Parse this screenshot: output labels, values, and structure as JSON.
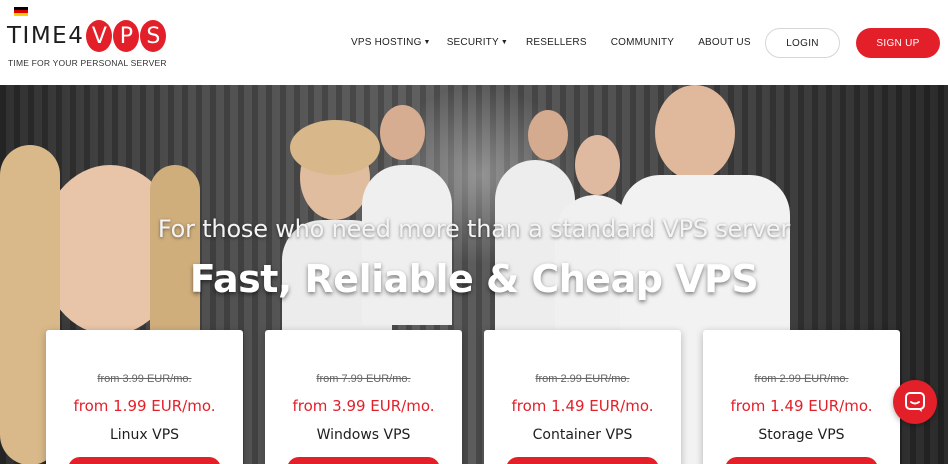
{
  "header": {
    "logo": {
      "text": "TIME4",
      "letters": [
        "V",
        "P",
        "S"
      ]
    },
    "tagline": "TIME FOR YOUR PERSONAL SERVER",
    "flag_colors": [
      "#000000",
      "#dd0000",
      "#ffce00"
    ],
    "nav": [
      {
        "label": "VPS HOSTING",
        "dropdown": true
      },
      {
        "label": "SECURITY",
        "dropdown": true
      },
      {
        "label": "RESELLERS",
        "dropdown": false
      },
      {
        "label": "COMMUNITY",
        "dropdown": false
      },
      {
        "label": "ABOUT US",
        "dropdown": false
      }
    ],
    "login_label": "LOGIN",
    "signup_label": "SIGN UP"
  },
  "hero": {
    "subtitle": "For those who need more than a standard VPS server",
    "title": "Fast, Reliable & Cheap VPS"
  },
  "cards": [
    {
      "old_price": "from 3.99 EUR/mo.",
      "price": "from 1.99 EUR/mo.",
      "name": "Linux VPS"
    },
    {
      "old_price": "from 7.99 EUR/mo.",
      "price": "from 3.99 EUR/mo.",
      "name": "Windows VPS"
    },
    {
      "old_price": "from 2.99 EUR/mo.",
      "price": "from 1.49 EUR/mo.",
      "name": "Container VPS"
    },
    {
      "old_price": "from 2.99 EUR/mo.",
      "price": "from 1.49 EUR/mo.",
      "name": "Storage VPS"
    }
  ],
  "colors": {
    "accent": "#e3202a",
    "text": "#1e1e1e"
  },
  "icons": {
    "chat": "chat-bubble-icon",
    "caret": "caret-down-icon",
    "flag": "german-flag-icon"
  }
}
